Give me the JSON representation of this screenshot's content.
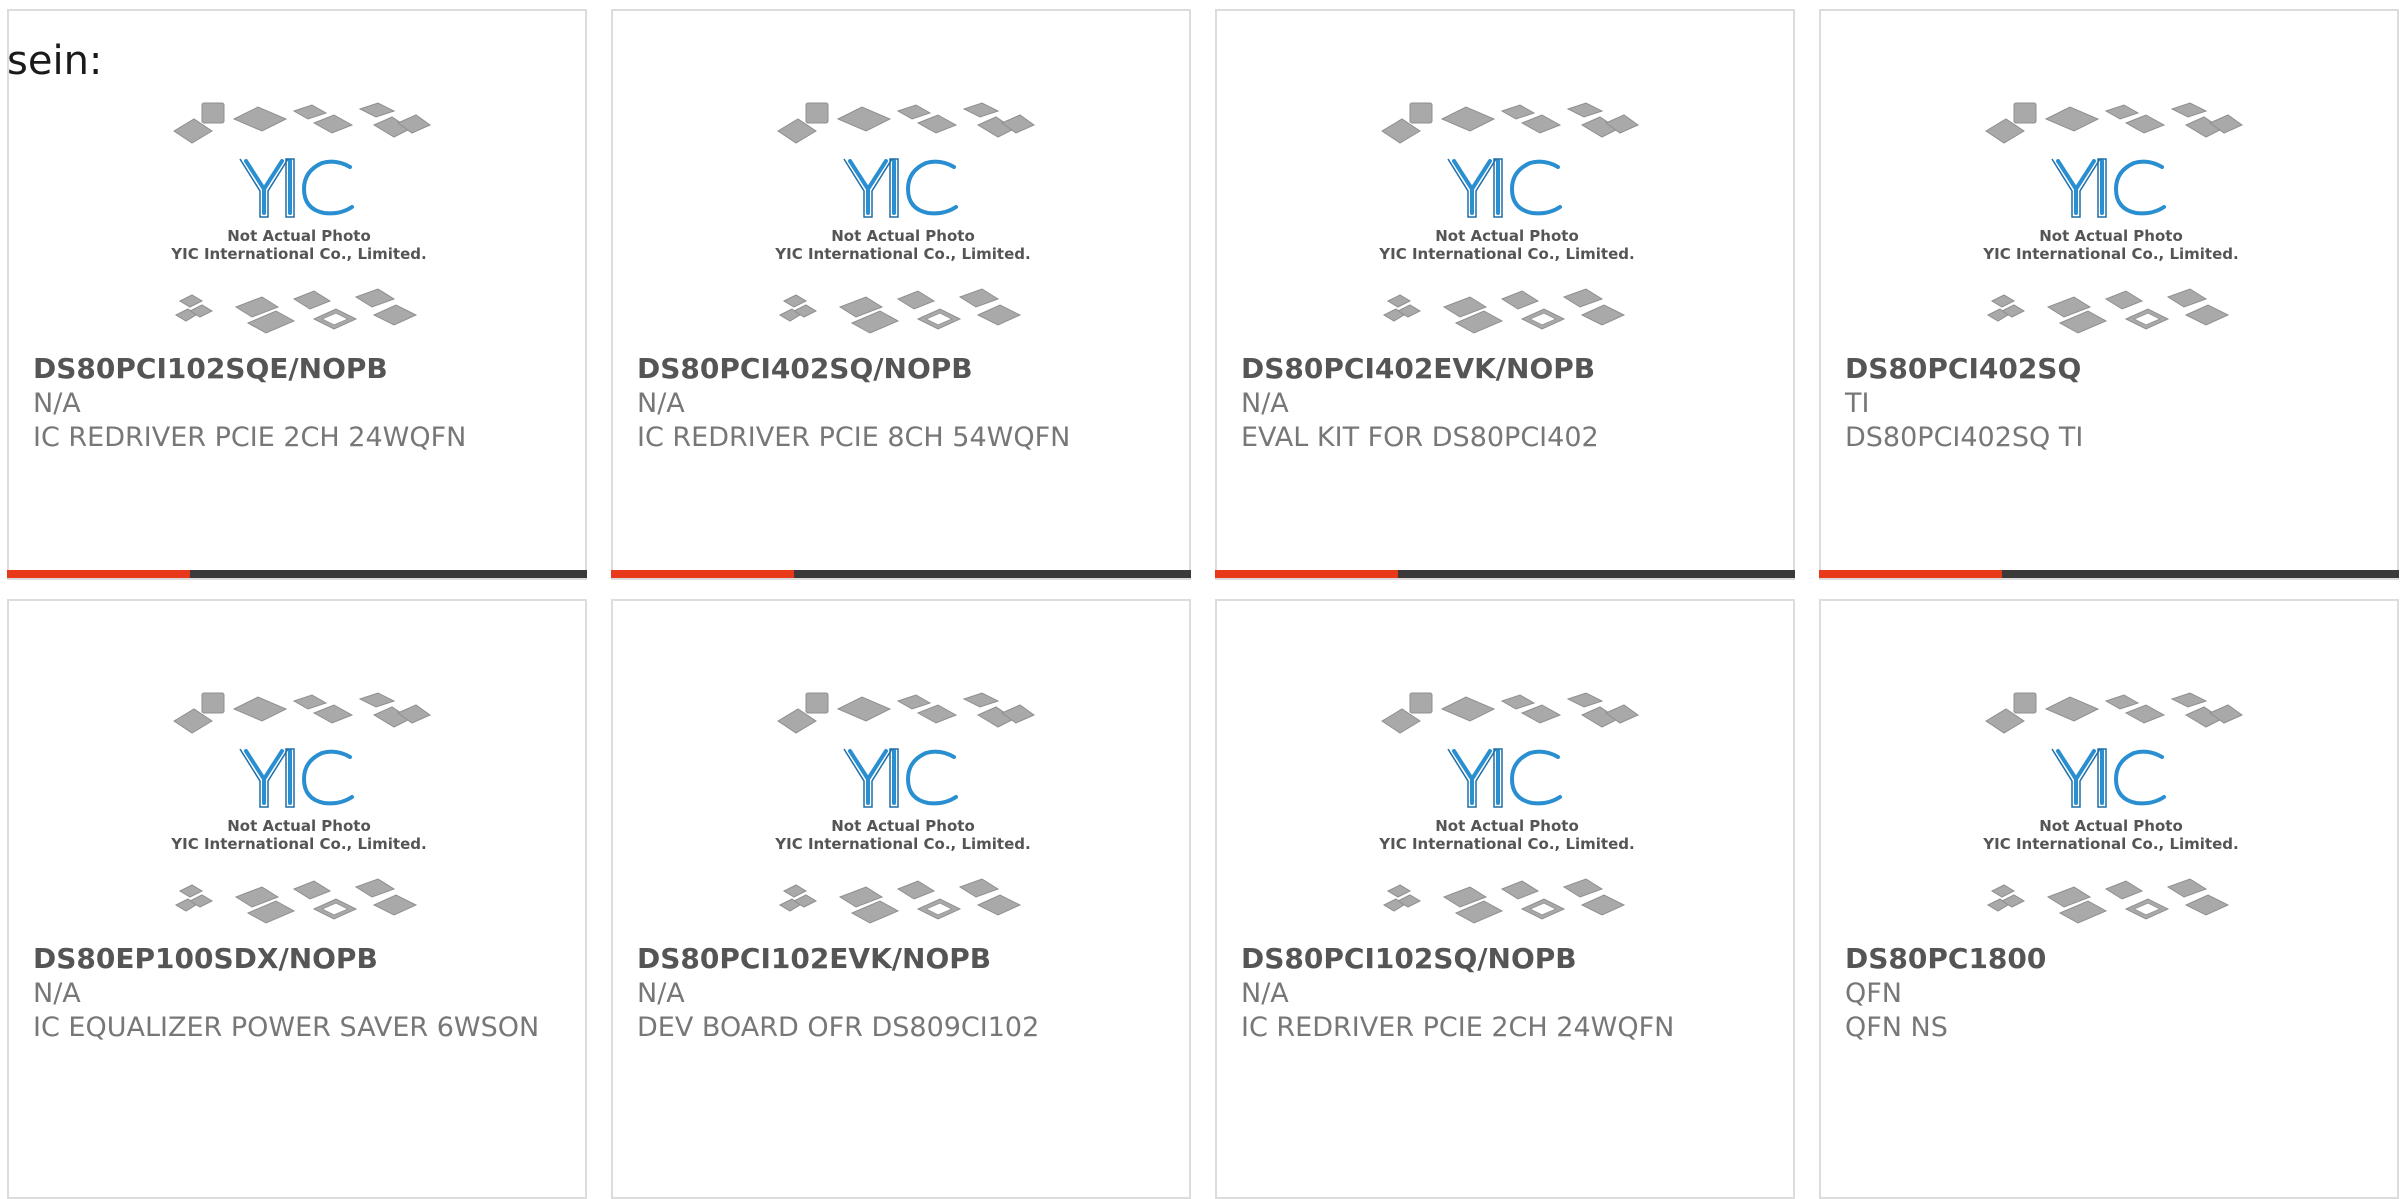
{
  "page": {
    "heading": "sein:"
  },
  "colors": {
    "accent": "#e8391b",
    "bar_dark": "#3a3a3a",
    "border": "#dcdcdc",
    "part_text": "#555555",
    "meta_text": "#777777",
    "logo_blue": "#2a8fd0"
  },
  "photo": {
    "icon": "placeholder-chip-photo",
    "line1": "Not Actual Photo",
    "line2": "YIC International Co., Limited.",
    "logo_text": "YIC"
  },
  "products": [
    {
      "part": "DS80PCI102SQE/NOPB",
      "manufacturer": "N/A",
      "description": "IC REDRIVER PCIE 2CH 24WQFN"
    },
    {
      "part": "DS80PCI402SQ/NOPB",
      "manufacturer": "N/A",
      "description": "IC REDRIVER PCIE 8CH 54WQFN"
    },
    {
      "part": "DS80PCI402EVK/NOPB",
      "manufacturer": "N/A",
      "description": "EVAL KIT FOR DS80PCI402"
    },
    {
      "part": "DS80PCI402SQ",
      "manufacturer": "TI",
      "description": "DS80PCI402SQ TI"
    },
    {
      "part": "DS80EP100SDX/NOPB",
      "manufacturer": "N/A",
      "description": "IC EQUALIZER POWER SAVER 6WSON"
    },
    {
      "part": "DS80PCI102EVK/NOPB",
      "manufacturer": "N/A",
      "description": "DEV BOARD OFR DS809CI102"
    },
    {
      "part": "DS80PCI102SQ/NOPB",
      "manufacturer": "N/A",
      "description": "IC REDRIVER PCIE 2CH 24WQFN"
    },
    {
      "part": "DS80PC1800",
      "manufacturer": "QFN",
      "description": "QFN NS"
    }
  ]
}
